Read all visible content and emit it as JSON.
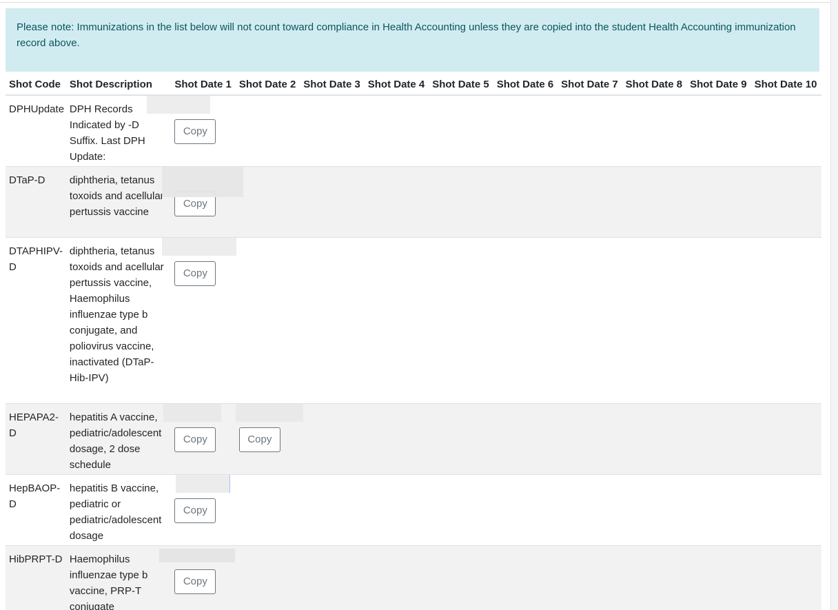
{
  "alert": {
    "text": "Please note: Immunizations in the list below will not count toward compliance in Health Accounting unless they are copied into the student Health Accounting immunization record above."
  },
  "table": {
    "headers": [
      "Shot Code",
      "Shot Description",
      "Shot Date 1",
      "Shot Date 2",
      "Shot Date 3",
      "Shot Date 4",
      "Shot Date 5",
      "Shot Date 6",
      "Shot Date 7",
      "Shot Date 8",
      "Shot Date 9",
      "Shot Date 10"
    ],
    "copy_label": "Copy",
    "rows": [
      {
        "code": "DPHUpdate",
        "description": "DPH Records Indicated by -D Suffix. Last DPH Update:",
        "copy1": "Copy"
      },
      {
        "code": "DTaP-D",
        "description": "diphtheria, tetanus toxoids and acellular pertussis vaccine",
        "copy1": "Copy"
      },
      {
        "code": "DTAPHIPV-D",
        "description": "diphtheria, tetanus toxoids and acellular pertussis vaccine, Haemophilus influenzae type b conjugate, and poliovirus vaccine, inactivated (DTaP-Hib-IPV)",
        "copy1": "Copy"
      },
      {
        "code": "HEPAPA2-D",
        "description": "hepatitis A vaccine, pediatric/adolescent dosage, 2 dose schedule",
        "copy1": "Copy",
        "copy2": "Copy"
      },
      {
        "code": "HepBAOP-D",
        "description": "hepatitis B vaccine, pediatric or pediatric/adolescent dosage",
        "copy1": "Copy"
      },
      {
        "code": "HibPRPT-D",
        "description": "Haemophilus influenzae type b vaccine, PRP-T conjugate",
        "copy1": "Copy"
      }
    ]
  }
}
